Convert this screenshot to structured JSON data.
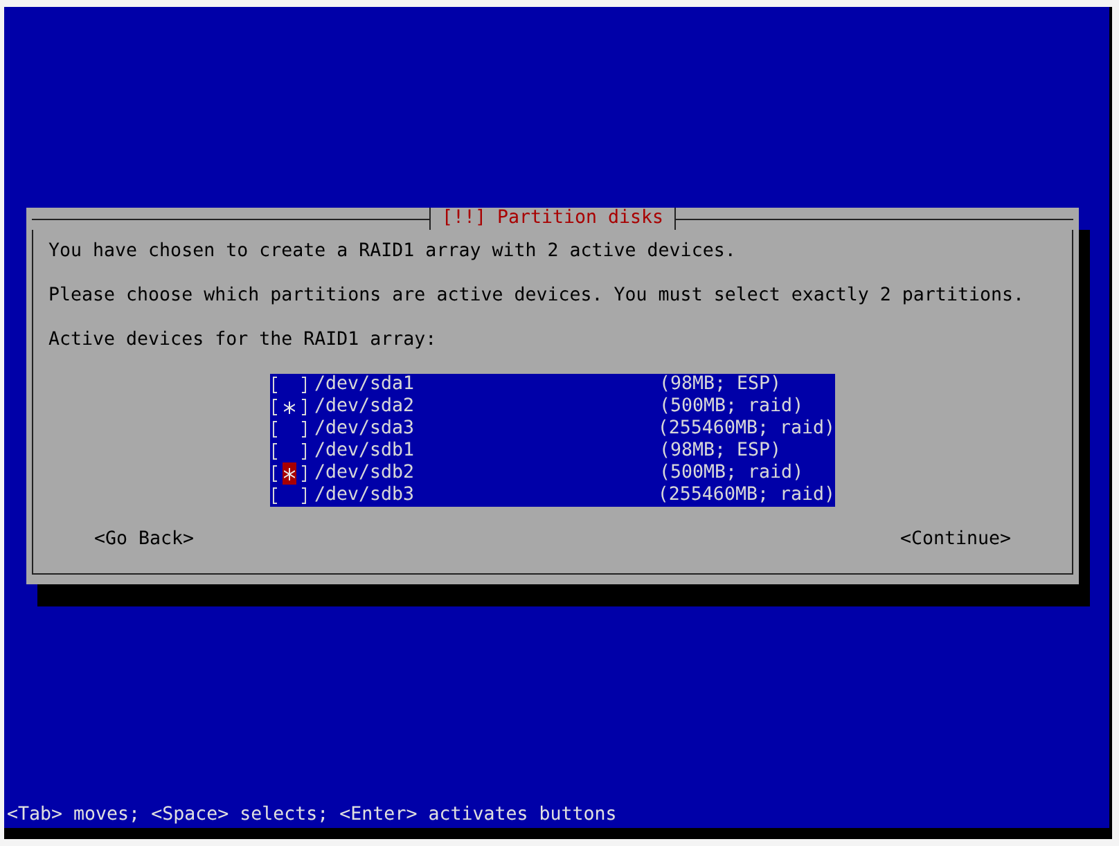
{
  "dialog": {
    "title": "[!!] Partition disks",
    "paragraphs": [
      "You have chosen to create a RAID1 array with 2 active devices.",
      "Please choose which partitions are active devices. You must select exactly 2 partitions.",
      "Active devices for the RAID1 array:"
    ],
    "devices": [
      {
        "device": "/dev/sda1",
        "size": "(98MB; ESP)",
        "checked": false,
        "focused": false
      },
      {
        "device": "/dev/sda2",
        "size": "(500MB; raid)",
        "checked": true,
        "focused": false
      },
      {
        "device": "/dev/sda3",
        "size": "(255460MB; raid)",
        "checked": false,
        "focused": false
      },
      {
        "device": "/dev/sdb1",
        "size": "(98MB; ESP)",
        "checked": false,
        "focused": false
      },
      {
        "device": "/dev/sdb2",
        "size": "(500MB; raid)",
        "checked": true,
        "focused": true
      },
      {
        "device": "/dev/sdb3",
        "size": "(255460MB; raid)",
        "checked": false,
        "focused": false
      }
    ],
    "buttons": [
      "<Go Back>",
      "<Continue>"
    ]
  },
  "status_bar": "<Tab> moves; <Space> selects; <Enter> activates buttons"
}
